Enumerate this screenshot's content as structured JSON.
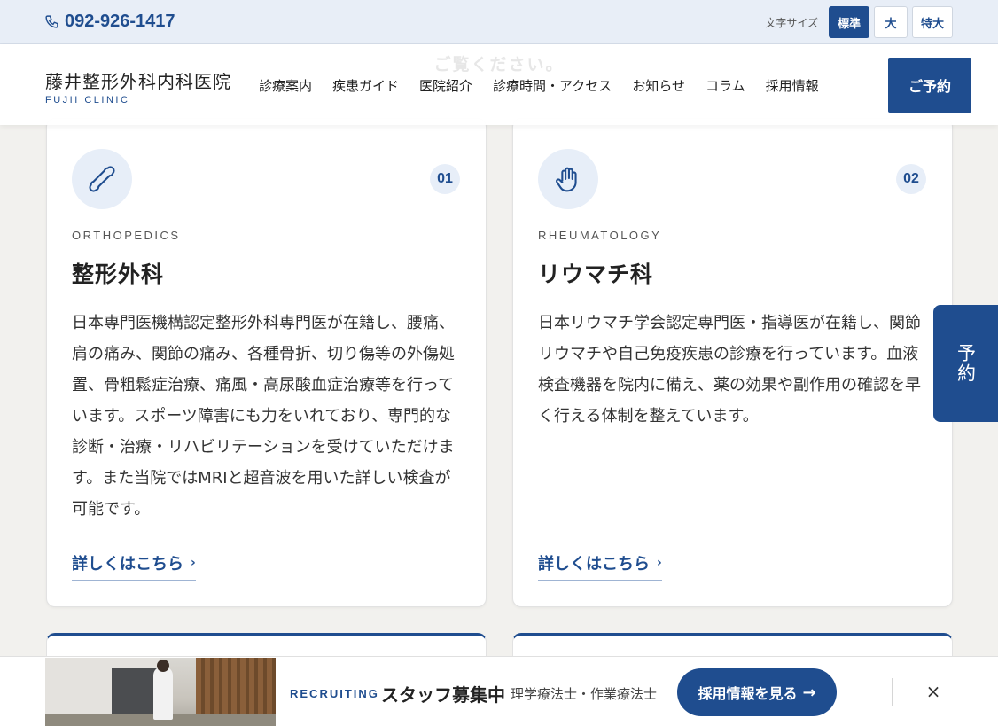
{
  "topbar": {
    "phone": "092-926-1417",
    "font_size_label": "文字サイズ",
    "font_sizes": [
      "標準",
      "大",
      "特大"
    ]
  },
  "header": {
    "ghost_text": "ご覧ください。",
    "logo_jp": "藤井整形外科内科医院",
    "logo_en": "FUJII CLINIC",
    "nav": [
      "診療案内",
      "疾患ガイド",
      "医院紹介",
      "診療時間・アクセス",
      "お知らせ",
      "コラム",
      "採用情報"
    ],
    "reserve": "ご予約"
  },
  "cards": [
    {
      "number": "01",
      "en": "ORTHOPEDICS",
      "title": "整形外科",
      "desc": "日本専門医機構認定整形外科専門医が在籍し、腰痛、肩の痛み、関節の痛み、各種骨折、切り傷等の外傷処置、骨粗鬆症治療、痛風・高尿酸血症治療等を行っています。スポーツ障害にも力をいれており、専門的な診断・治療・リハビリテーションを受けていただけます。また当院ではMRIと超音波を用いた詳しい検査が可能です。",
      "more": "詳しくはこちら",
      "icon": "bone-icon"
    },
    {
      "number": "02",
      "en": "RHEUMATOLOGY",
      "title": "リウマチ科",
      "desc": "日本リウマチ学会認定専門医・指導医が在籍し、関節リウマチや自己免疫疾患の診療を行っています。血液検査機器を院内に備え、薬の効果や副作用の確認を早く行える体制を整えています。",
      "more": "詳しくはこちら",
      "icon": "hand-icon"
    }
  ],
  "side_reserve": "予約",
  "recruit": {
    "label": "RECRUITING",
    "title": "スタッフ募集中",
    "sub": "理学療法士・作業療法士",
    "button": "採用情報を見る",
    "close": "×"
  },
  "colors": {
    "brand": "#1f4d8f",
    "topbar_bg": "#e8eef7",
    "page_bg": "#f2f1ee"
  }
}
